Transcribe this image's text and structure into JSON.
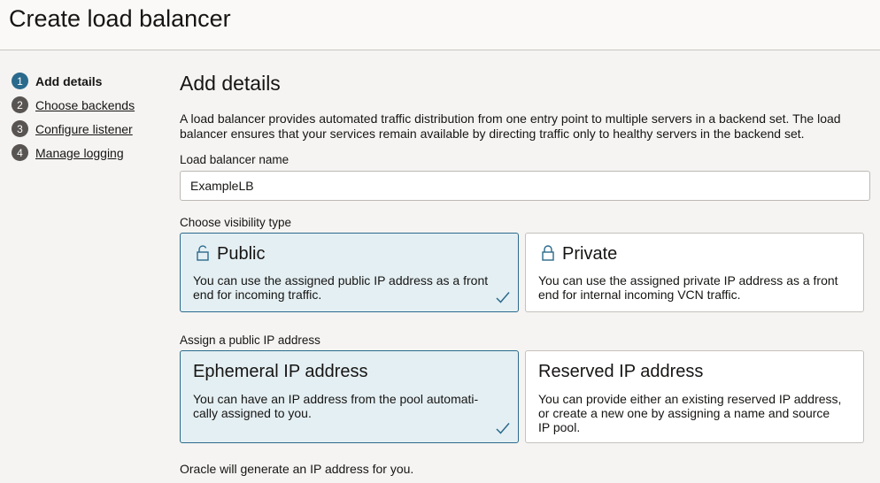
{
  "header": {
    "title": "Create load balancer"
  },
  "steps": [
    {
      "num": "1",
      "label": "Add details"
    },
    {
      "num": "2",
      "label": "Choose backends"
    },
    {
      "num": "3",
      "label": "Configure listener"
    },
    {
      "num": "4",
      "label": "Manage logging"
    }
  ],
  "main": {
    "title": "Add details",
    "description": "A load balancer provides automated traffic distribution from one entry point to multiple servers in a backend set. The load balancer ensures that your services remain available by directing traffic only to healthy servers in the backend set.",
    "name_label": "Load balancer name",
    "name_value": "ExampleLB",
    "visibility_label": "Choose visibility type",
    "visibility": {
      "public": {
        "title": "Public",
        "desc": "You can use the assigned public IP address as a front end for incoming traffic."
      },
      "private": {
        "title": "Private",
        "desc": "You can use the assigned private IP address as a front end for internal incoming VCN traffic."
      }
    },
    "ip_label": "Assign a public IP address",
    "ip": {
      "ephemeral": {
        "title": "Ephemeral IP address",
        "desc": "You can have an IP address from the pool automati-cally assigned to you."
      },
      "reserved": {
        "title": "Reserved IP address",
        "desc": "You can provide either an existing reserved IP address, or create a new one by assigning a name and source IP pool."
      }
    },
    "footer_note": "Oracle will generate an IP address for you."
  },
  "colors": {
    "accent": "#2a6a8c",
    "selected_bg": "#e4eff3"
  }
}
